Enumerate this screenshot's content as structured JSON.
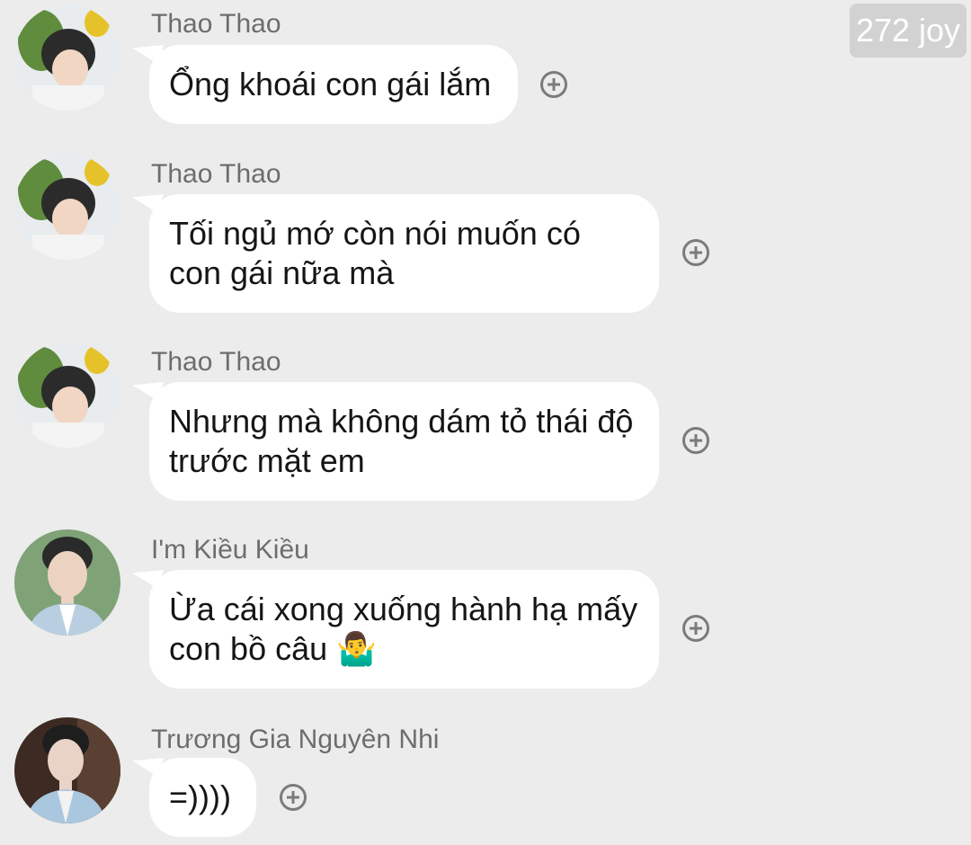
{
  "watermark": "272 joy",
  "messages": [
    {
      "sender": "Thao Thao",
      "avatar": "sunflower-portrait",
      "lines": [
        "Ổng khoái con gái lắm"
      ]
    },
    {
      "sender": "Thao Thao",
      "avatar": "sunflower-portrait",
      "lines": [
        "Tối ngủ mớ còn nói muốn có",
        "con gái nữa mà"
      ]
    },
    {
      "sender": "Thao Thao",
      "avatar": "sunflower-portrait",
      "lines": [
        "Nhưng mà không dám tỏ thái độ",
        "trước mặt em"
      ]
    },
    {
      "sender": "I'm Kiều Kiều",
      "avatar": "man-portrait-green",
      "lines": [
        "Ừa cái xong xuống hành hạ mấy",
        "con bồ câu 🤷‍♂️"
      ]
    },
    {
      "sender": "Trương Gia Nguyên Nhi",
      "avatar": "man-portrait-indoor",
      "lines": [
        "=))))"
      ]
    }
  ]
}
